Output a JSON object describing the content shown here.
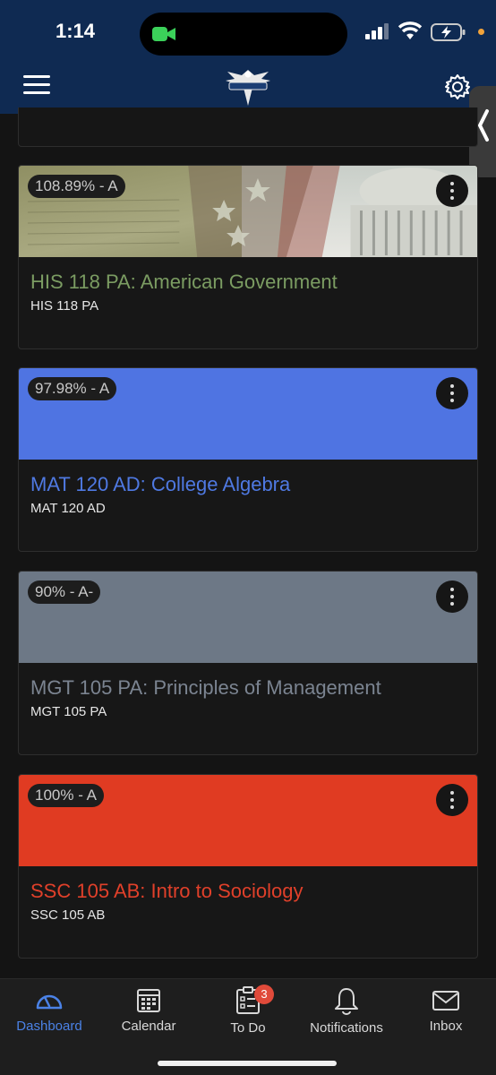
{
  "status_bar": {
    "time": "1:14"
  },
  "header": {
    "logo": "eagle-logo"
  },
  "courses": [
    {
      "grade": "108.89% - A",
      "title": "HIS 118 PA: American Government",
      "code": "HIS 118 PA",
      "title_color": "#7b9c62",
      "banner": "image"
    },
    {
      "grade": "97.98% - A",
      "title": "MAT 120 AD: College Algebra",
      "code": "MAT 120 AD",
      "title_color": "#4f79e2",
      "banner": "#4f74e2"
    },
    {
      "grade": "90% - A-",
      "title": "MGT 105 PA: Principles of Management",
      "code": "MGT 105 PA",
      "title_color": "#7b8491",
      "banner": "#6d7886"
    },
    {
      "grade": "100% - A",
      "title": "SSC 105 AB: Intro to Sociology",
      "code": "SSC 105 AB",
      "title_color": "#e0402a",
      "banner": "#e03b22"
    }
  ],
  "tabbar": {
    "tabs": [
      {
        "label": "Dashboard",
        "icon": "dashboard-icon",
        "active": true
      },
      {
        "label": "Calendar",
        "icon": "calendar-icon"
      },
      {
        "label": "To Do",
        "icon": "todo-icon",
        "badge": "3"
      },
      {
        "label": "Notifications",
        "icon": "bell-icon"
      },
      {
        "label": "Inbox",
        "icon": "mail-icon"
      }
    ]
  }
}
